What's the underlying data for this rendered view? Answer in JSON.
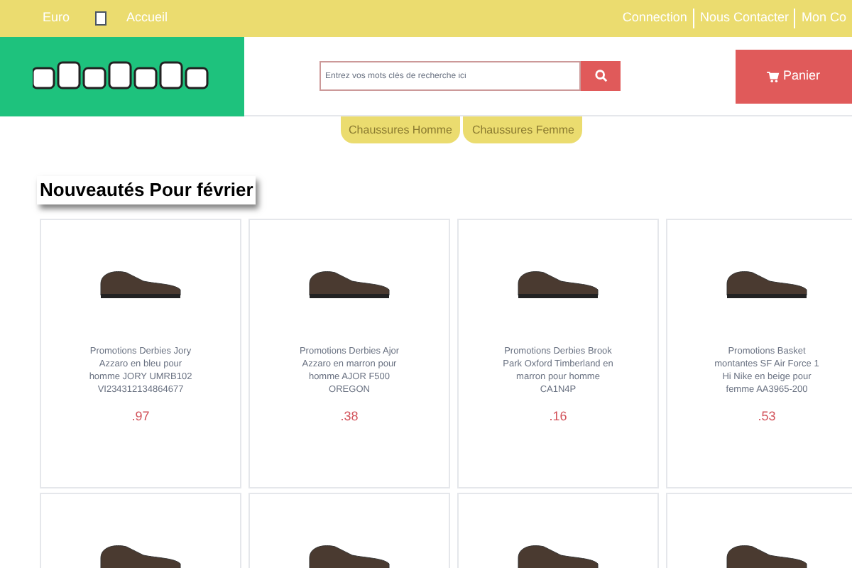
{
  "top_bar": {
    "currency": "Euro",
    "home_link": "Accueil",
    "links": [
      "Connection",
      "Nous Contacter",
      "Mon Co"
    ]
  },
  "search": {
    "placeholder": "Entrez vos mots clés de recherche ici"
  },
  "cart": {
    "label": "Panier"
  },
  "nav_tabs": [
    {
      "label": "Chaussures Homme",
      "selected": false
    },
    {
      "label": "Chaussures Femme",
      "selected": false
    }
  ],
  "section_title": "Nouveautés Pour février",
  "products": [
    {
      "kind": "full",
      "description": "Promotions Derbies Jory Azzaro en bleu pour homme JORY UMRB102 VI234312134864677",
      "price": ".97"
    },
    {
      "kind": "full",
      "description": "Promotions Derbies Ajor Azzaro en marron pour homme AJOR F500 OREGON",
      "price": ".38"
    },
    {
      "kind": "full",
      "description": "Promotions Derbies Brook Park Oxford Timberland en marron pour homme CA1N4P",
      "price": ".16"
    },
    {
      "kind": "full",
      "description": "Promotions Basket montantes SF Air Force 1 Hi Nike en beige pour femme AA3965-200",
      "price": ".53"
    },
    {
      "kind": "image_only"
    },
    {
      "kind": "image_only"
    },
    {
      "kind": "image_only"
    },
    {
      "kind": "image_only"
    }
  ]
}
